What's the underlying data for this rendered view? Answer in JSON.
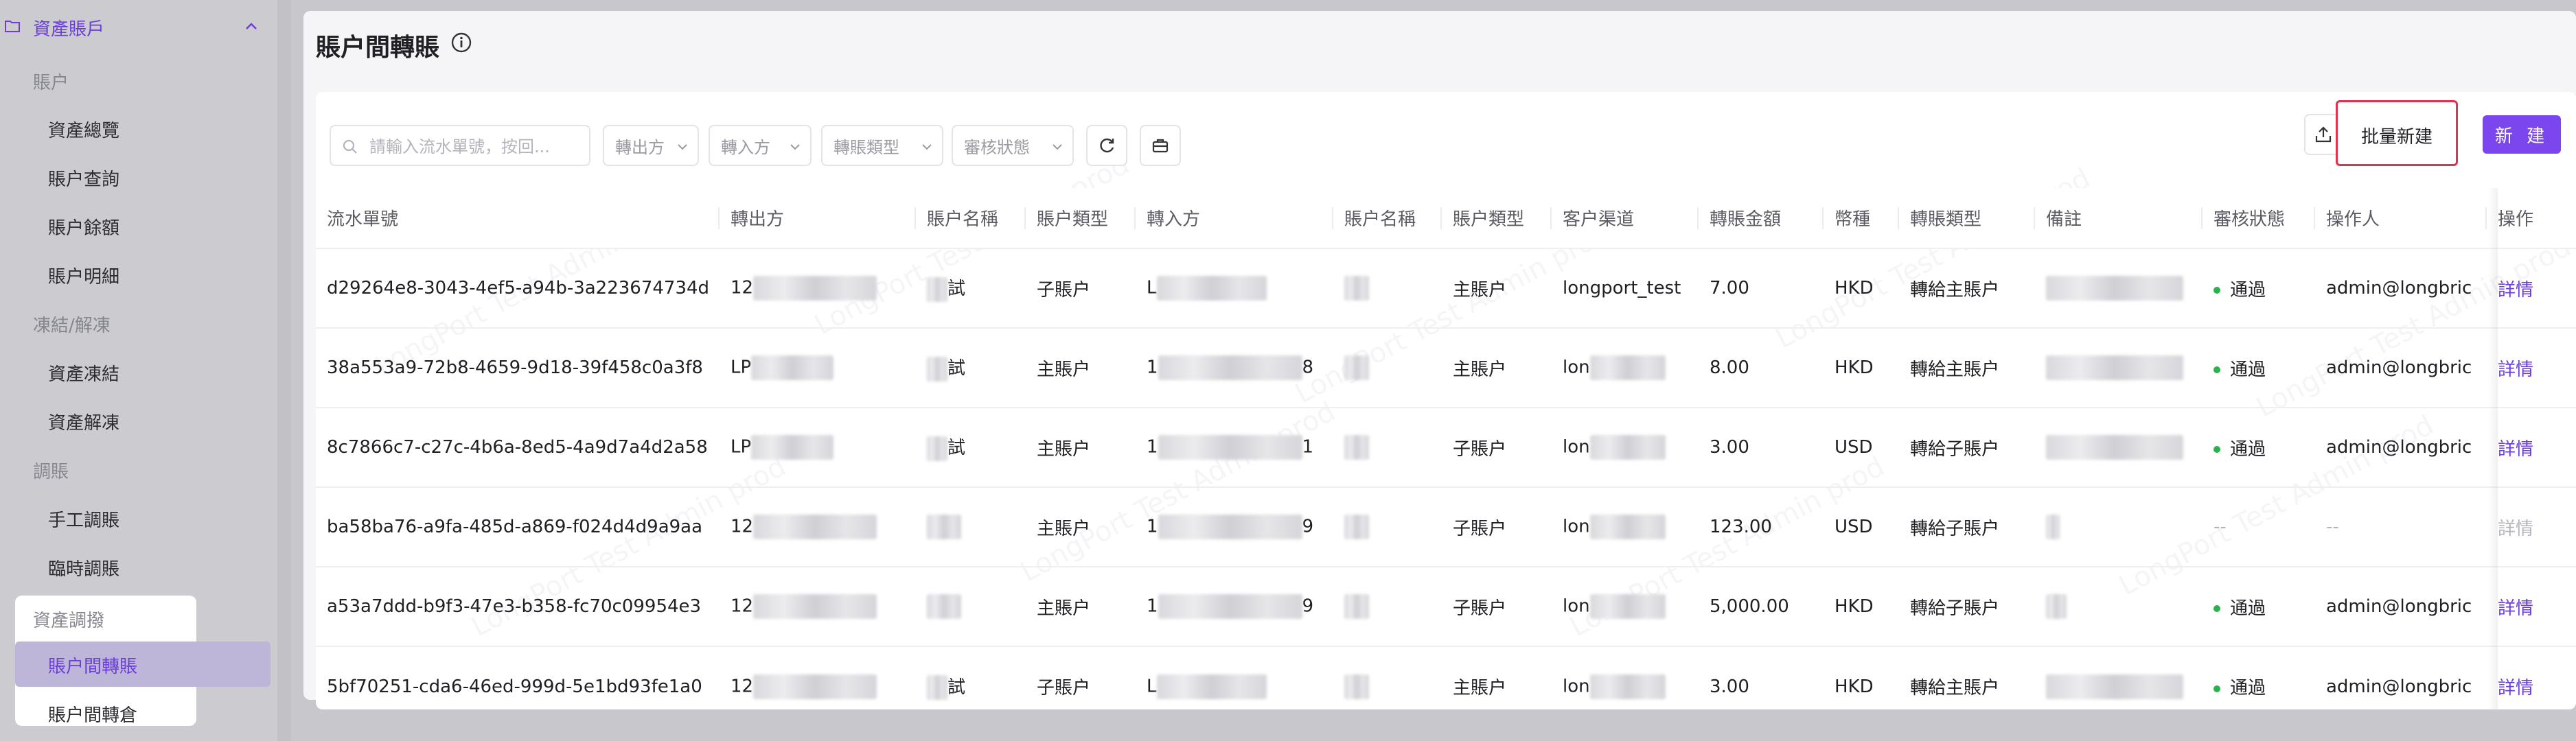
{
  "sidebar": {
    "group_header": "資產賬戶",
    "sections": [
      {
        "title": "賬户",
        "items": [
          "資產總覽",
          "賬户查詢",
          "賬户餘額",
          "賬户明細"
        ]
      },
      {
        "title": "凍結/解凍",
        "items": [
          "資產凍結",
          "資產解凍"
        ]
      },
      {
        "title": "調賬",
        "items": [
          "手工調賬",
          "臨時調賬"
        ]
      }
    ],
    "popup": {
      "title": "資產調撥",
      "active": "賬户間轉賬",
      "last": "賬户間轉倉"
    }
  },
  "page": {
    "title": "賬户間轉賬"
  },
  "toolbar": {
    "search_placeholder": "請輸入流水單號，按回...",
    "filters": [
      "轉出方",
      "轉入方",
      "轉賬類型",
      "審核狀態"
    ],
    "batch_new": "批量新建",
    "new": "新 建"
  },
  "watermark": "LongPort Test Admin prod",
  "table": {
    "headers": [
      "流水單號",
      "轉出方",
      "賬户名稱",
      "賬户類型",
      "轉入方",
      "賬户名稱",
      "賬户類型",
      "客户渠道",
      "轉賬金額",
      "幣種",
      "轉賬類型",
      "備註",
      "審核狀態",
      "操作人",
      "操作"
    ],
    "rows": [
      {
        "id": "d29264e8-3043-4ef5-a94b-3a223674734d",
        "from": "12",
        "from_name": "試",
        "from_type": "子賬户",
        "to": "L",
        "to_name": "",
        "to_type": "主賬户",
        "channel": "longport_test",
        "amount": "7.00",
        "currency": "HKD",
        "transfer_type": "轉給主賬户",
        "status": "通過",
        "operator": "admin@longbric",
        "action": "詳情"
      },
      {
        "id": "38a553a9-72b8-4659-9d18-39f458c0a3f8",
        "from": "LP",
        "from_name": "試",
        "from_type": "主賬户",
        "to": "1",
        "to_suffix": "8",
        "to_name": "",
        "to_type": "主賬户",
        "channel": "lon",
        "amount": "8.00",
        "currency": "HKD",
        "transfer_type": "轉給主賬户",
        "status": "通過",
        "operator": "admin@longbric",
        "action": "詳情"
      },
      {
        "id": "8c7866c7-c27c-4b6a-8ed5-4a9d7a4d2a58",
        "from": "LP",
        "from_name": "試",
        "from_type": "主賬户",
        "to": "1",
        "to_suffix": "1",
        "to_name": "",
        "to_type": "子賬户",
        "channel": "lon",
        "amount": "3.00",
        "currency": "USD",
        "transfer_type": "轉給子賬户",
        "status": "通過",
        "operator": "admin@longbric",
        "action": "詳情"
      },
      {
        "id": "ba58ba76-a9fa-485d-a869-f024d4d9a9aa",
        "from": "12",
        "from_name": "",
        "from_type": "主賬户",
        "to": "1",
        "to_suffix": "9",
        "to_name": "",
        "to_type": "子賬户",
        "channel": "lon",
        "amount": "123.00",
        "currency": "USD",
        "transfer_type": "轉給子賬户",
        "status": "--",
        "operator": "--",
        "action": "詳情"
      },
      {
        "id": "a53a7ddd-b9f3-47e3-b358-fc70c09954e3",
        "from": "12",
        "from_name": "",
        "from_type": "主賬户",
        "to": "1",
        "to_suffix": "9",
        "to_name": "",
        "to_type": "子賬户",
        "channel": "lon",
        "amount": "5,000.00",
        "currency": "HKD",
        "transfer_type": "轉給子賬户",
        "status": "通過",
        "operator": "admin@longbric",
        "action": "詳情"
      },
      {
        "id": "5bf70251-cda6-46ed-999d-5e1bd93fe1a0",
        "from": "12",
        "from_name": "試",
        "from_type": "子賬户",
        "to": "L",
        "to_name": "",
        "to_type": "主賬户",
        "channel": "lon",
        "amount": "3.00",
        "currency": "HKD",
        "transfer_type": "轉給主賬户",
        "status": "通過",
        "operator": "admin@longbric",
        "action": "詳情"
      }
    ]
  },
  "colors": {
    "accent": "#7b46ee",
    "status_ok": "#2bb24c",
    "highlight": "#e5304b"
  }
}
